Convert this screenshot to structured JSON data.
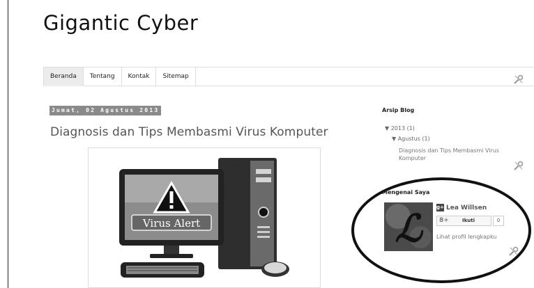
{
  "blog": {
    "title": "Gigantic Cyber"
  },
  "nav": {
    "tabs": [
      {
        "label": "Beranda",
        "active": true
      },
      {
        "label": "Tentang",
        "active": false
      },
      {
        "label": "Kontak",
        "active": false
      },
      {
        "label": "Sitemap",
        "active": false
      }
    ]
  },
  "post": {
    "date_header": "Jumat, 02 Agustus 2013",
    "title": "Diagnosis dan Tips Membasmi Virus Komputer",
    "image": {
      "alert_text": "Virus Alert"
    }
  },
  "sidebar": {
    "archive": {
      "title": "Arsip Blog",
      "year": "▼ 2013 (1)",
      "month": "▼ Agustus (1)",
      "post": "Diagnosis dan Tips Membasmi Virus Komputer"
    },
    "about": {
      "title": "Mengenai Saya",
      "name": "Lea Willsen",
      "follow_label": "Ikuti",
      "follow_count": "0",
      "profile_link": "Lihat profil lengkapku"
    }
  },
  "icons": {
    "edit": "wrench-screwdriver-icon",
    "gplus": "google-plus-icon",
    "warning": "warning-triangle-icon"
  },
  "colors": {
    "date_badge_bg": "#8a8a8a",
    "active_tab_bg": "#ececec",
    "ellipse_stroke": "#111111"
  }
}
